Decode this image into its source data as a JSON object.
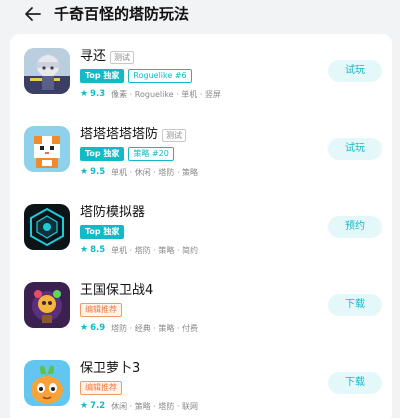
{
  "header": {
    "back_icon": "arrow-left-icon",
    "title": "千奇百怪的塔防玩法"
  },
  "colors": {
    "accent": "#14b9c7",
    "accent_bg": "#e4f8fa",
    "editor_tag": "#f07a3e"
  },
  "games": [
    {
      "name": "寻还",
      "test_label": "测试",
      "tags": [
        "Top 独家",
        "Roguelike #6"
      ],
      "rating": "9.3",
      "meta": "像素 · Roguelike · 单机 · 竖屏",
      "action": "试玩"
    },
    {
      "name": "塔塔塔塔塔防",
      "test_label": "测试",
      "tags": [
        "Top 独家",
        "策略 #20"
      ],
      "rating": "9.5",
      "meta": "单机 · 休闲 · 塔防 · 策略",
      "action": "试玩"
    },
    {
      "name": "塔防模拟器",
      "tags": [
        "Top 独家"
      ],
      "rating": "8.5",
      "meta": "单机 · 塔防 · 策略 · 简约",
      "action": "预约"
    },
    {
      "name": "王国保卫战4",
      "tags": [
        "编辑推荐"
      ],
      "rating": "6.9",
      "meta": "塔防 · 经典 · 策略 · 付费",
      "action": "下载"
    },
    {
      "name": "保卫萝卜3",
      "tags": [
        "编辑推荐"
      ],
      "rating": "7.2",
      "meta": "休闲 · 策略 · 塔防 · 联网",
      "action": "下载"
    }
  ]
}
